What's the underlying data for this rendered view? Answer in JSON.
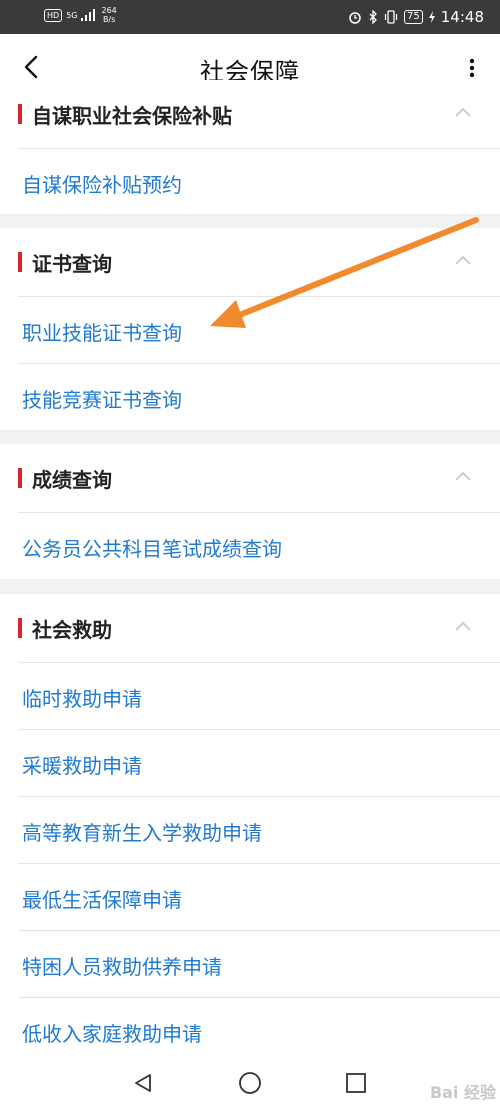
{
  "status_bar": {
    "hd": "HD",
    "network": "5G",
    "speed_value": "264",
    "speed_unit": "B/s",
    "battery": "75",
    "time": "14:48"
  },
  "header": {
    "title": "社会保障"
  },
  "sections": [
    {
      "title": "自谋职业社会保险补贴",
      "items": [
        "自谋保险补贴预约"
      ]
    },
    {
      "title": "证书查询",
      "items": [
        "职业技能证书查询",
        "技能竞赛证书查询"
      ]
    },
    {
      "title": "成绩查询",
      "items": [
        "公务员公共科目笔试成绩查询"
      ]
    },
    {
      "title": "社会救助",
      "items": [
        "临时救助申请",
        "采暖救助申请",
        "高等教育新生入学救助申请",
        "最低生活保障申请",
        "特困人员救助供养申请",
        "低收入家庭救助申请"
      ]
    }
  ],
  "watermark": "Bai 经验",
  "colors": {
    "accent_red": "#d9262c",
    "link_blue": "#1f7ad0",
    "arrow_orange": "#f08a2c"
  }
}
